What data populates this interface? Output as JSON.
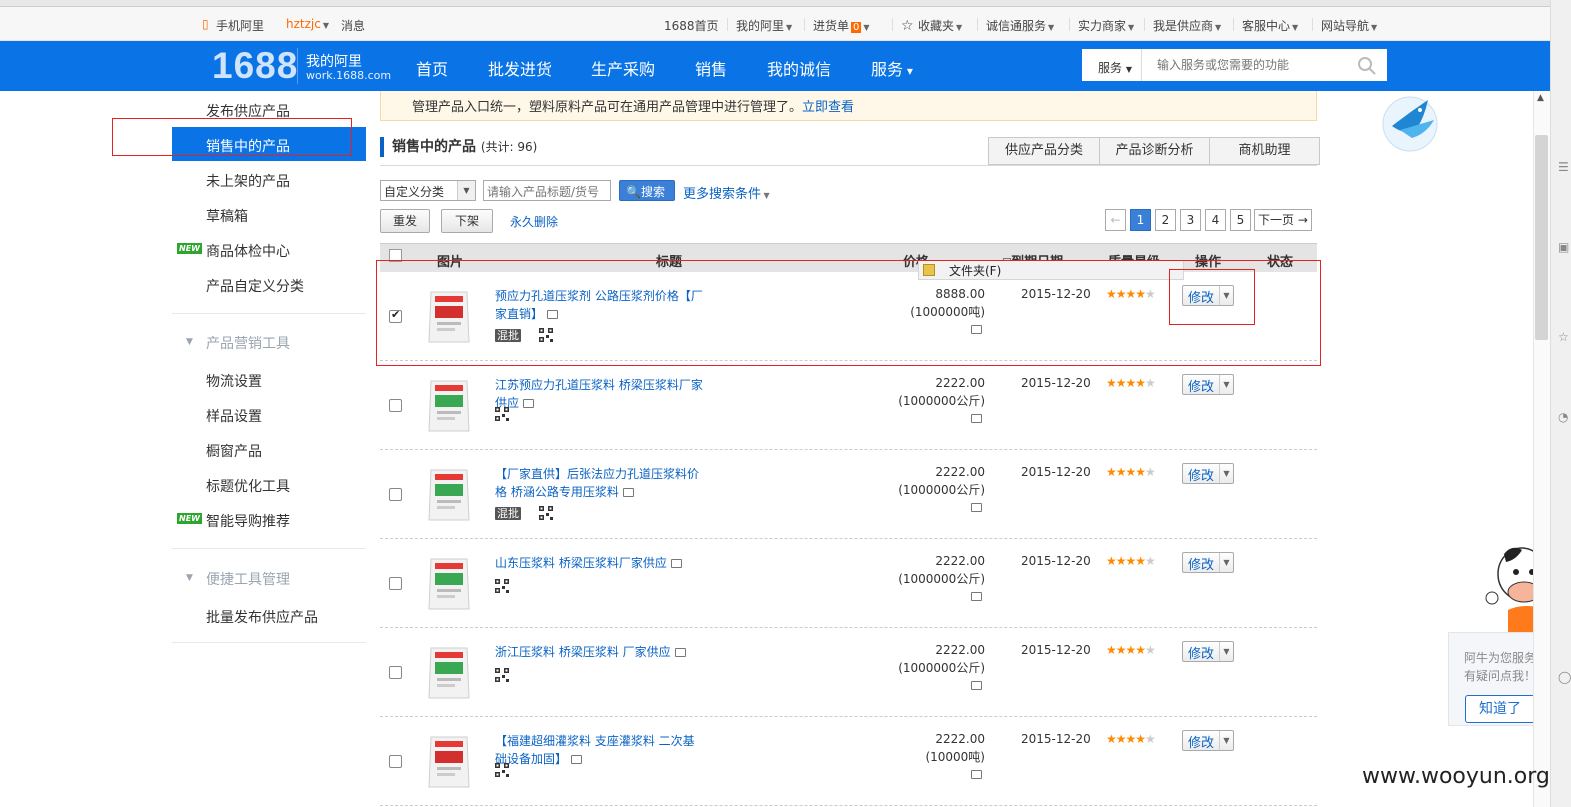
{
  "topbar": {
    "mobile": "手机阿里",
    "user": "hztzjc",
    "messages": "消息",
    "links": [
      {
        "label": "1688首页",
        "caret": false
      },
      {
        "label": "我的阿里",
        "caret": true
      },
      {
        "label": "进货单",
        "caret": true,
        "badge": "0"
      },
      {
        "label": "收藏夹",
        "caret": true
      },
      {
        "label": "诚信通服务",
        "caret": true
      },
      {
        "label": "实力商家",
        "caret": true
      },
      {
        "label": "我是供应商",
        "caret": true
      },
      {
        "label": "客服中心",
        "caret": true
      },
      {
        "label": "网站导航",
        "caret": true
      }
    ]
  },
  "nav": {
    "logo": "1688",
    "my_ali": "我的阿里",
    "my_ali_sub": "work.1688.com",
    "items": [
      "首页",
      "批发进货",
      "生产采购",
      "销售",
      "我的诚信",
      "服务"
    ],
    "search_select": "服务",
    "search_placeholder": "输入服务或您需要的功能"
  },
  "sidebar": {
    "items": [
      "发布供应产品",
      "销售中的产品",
      "未上架的产品",
      "草稿箱",
      "商品体检中心",
      "产品自定义分类"
    ],
    "group2_title": "产品营销工具",
    "group2": [
      "物流设置",
      "样品设置",
      "橱窗产品",
      "标题优化工具",
      "智能导购推荐"
    ],
    "group3_title": "便捷工具管理",
    "group3": [
      "批量发布供应产品"
    ],
    "new_badge": "NEW"
  },
  "notice": {
    "text": "管理产品入口统一，塑料原料产品可在通用产品管理中进行管理了。",
    "link": "立即查看"
  },
  "section": {
    "title": "销售中的产品",
    "count": "(共计: 96)",
    "tabs": [
      "供应产品分类",
      "产品诊断分析",
      "商机助理"
    ]
  },
  "filter": {
    "category": "自定义分类",
    "keyword_placeholder": "请输入产品标题/货号",
    "search": "搜索",
    "more": "更多搜索条件"
  },
  "actions": {
    "relist": "重发",
    "delist": "下架",
    "delete": "永久删除"
  },
  "pager": {
    "pages": [
      "1",
      "2",
      "3",
      "4",
      "5"
    ],
    "next": "下一页",
    "current": "1"
  },
  "table": {
    "headers": [
      "图片",
      "标题",
      "价格",
      "到期日期",
      "质量星级",
      "操作",
      "状态"
    ],
    "edit_label": "修改",
    "mixed_tag": "混批",
    "rows": [
      {
        "title": "预应力孔道压浆剂 公路压浆剂价格【厂家直销】",
        "price": "8888.00",
        "unit": "(1000000吨)",
        "date": "2015-12-20",
        "stars": 4,
        "checked": true,
        "tag": true
      },
      {
        "title": "江苏预应力孔道压浆料 桥梁压浆料厂家供应",
        "price": "2222.00",
        "unit": "(1000000公斤)",
        "date": "2015-12-20",
        "stars": 4,
        "checked": false,
        "tag": false
      },
      {
        "title": "【厂家直供】后张法应力孔道压浆料价格 桥涵公路专用压浆料",
        "price": "2222.00",
        "unit": "(1000000公斤)",
        "date": "2015-12-20",
        "stars": 4,
        "checked": false,
        "tag": true
      },
      {
        "title": "山东压浆料 桥梁压浆料厂家供应",
        "price": "2222.00",
        "unit": "(1000000公斤)",
        "date": "2015-12-20",
        "stars": 4,
        "checked": false,
        "tag": false
      },
      {
        "title": "浙江压浆料 桥梁压浆料 厂家供应",
        "price": "2222.00",
        "unit": "(1000000公斤)",
        "date": "2015-12-20",
        "stars": 4,
        "checked": false,
        "tag": false
      },
      {
        "title": "【福建超细灌浆料 支座灌浆料 二次基础设备加固】",
        "price": "2222.00",
        "unit": "(10000吨)",
        "date": "2015-12-20",
        "stars": 4,
        "checked": false,
        "tag": false
      }
    ]
  },
  "tooltip": {
    "text": "文件夹(F)"
  },
  "help": {
    "line1": "阿牛为您服务",
    "line2": "有疑问点我！",
    "button": "知道了"
  },
  "watermark": "www.wooyun.org",
  "colors": {
    "brand": "#0a73e6",
    "link": "#0a63c4",
    "star": "#ff8a00",
    "highlight": "#e52222"
  }
}
